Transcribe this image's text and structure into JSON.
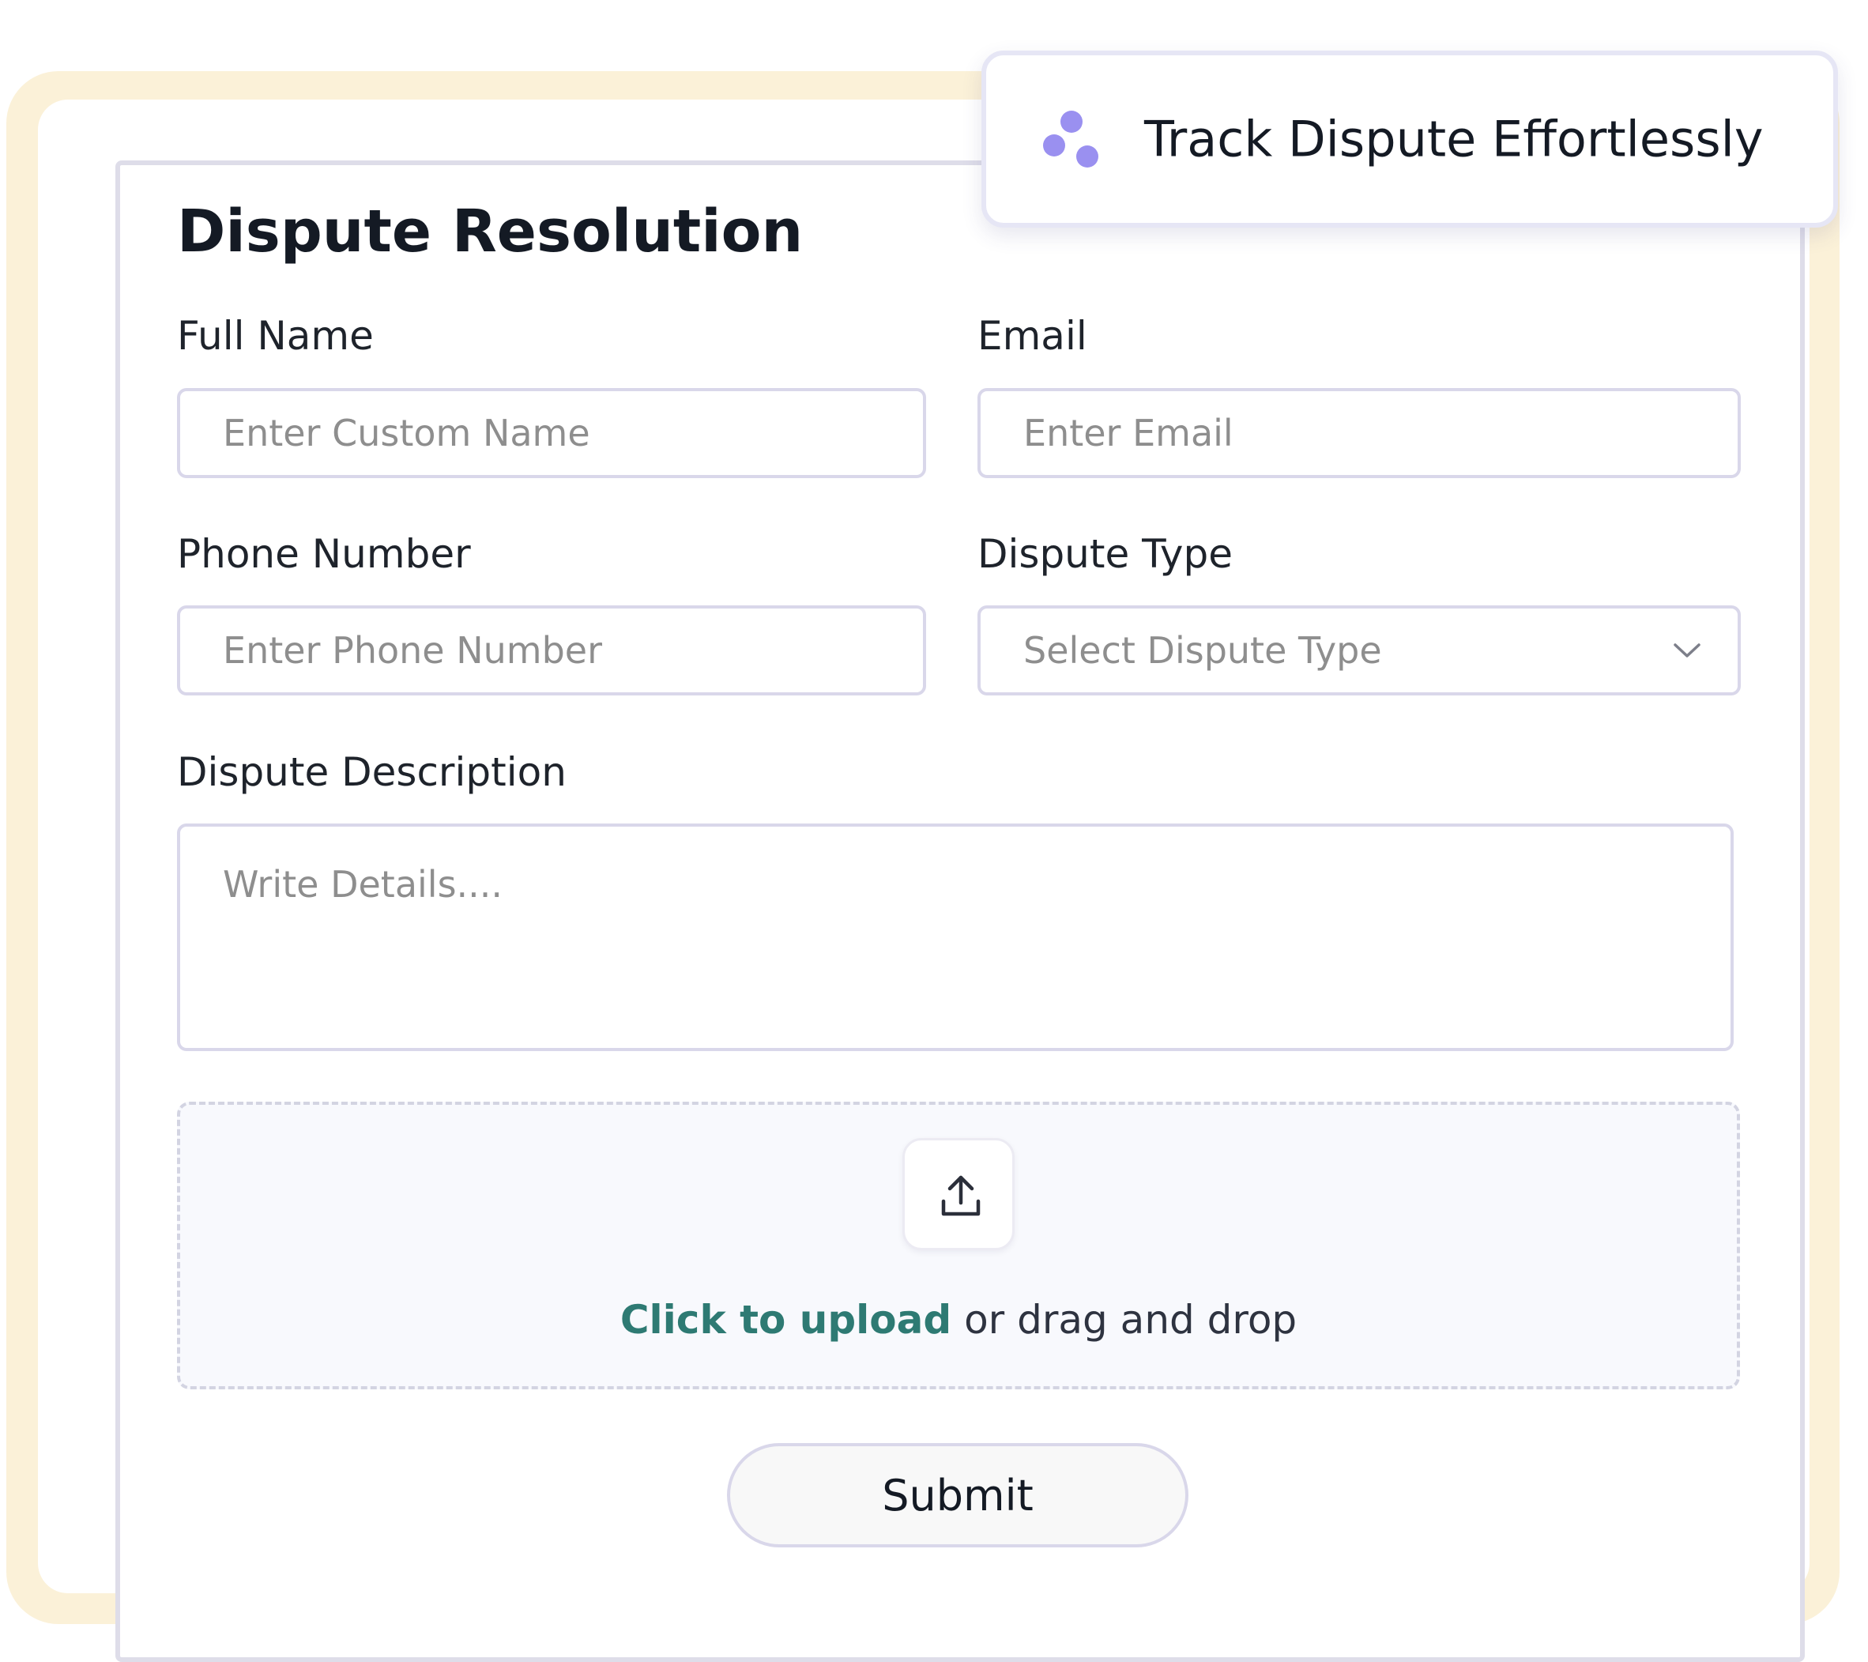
{
  "form": {
    "title": "Dispute Resolution",
    "full_name": {
      "label": "Full Name",
      "placeholder": "Enter Custom Name",
      "value": ""
    },
    "email": {
      "label": "Email",
      "placeholder": "Enter Email",
      "value": ""
    },
    "phone": {
      "label": "Phone Number",
      "placeholder": "Enter Phone Number",
      "value": ""
    },
    "dispute_type": {
      "label": "Dispute Type",
      "selected": "Select Dispute Type"
    },
    "description": {
      "label": "Dispute Description",
      "placeholder": "Write Details....",
      "value": ""
    },
    "upload": {
      "link_text": "Click to upload",
      "rest_text": "or drag and drop",
      "icon": "upload-icon"
    },
    "submit_label": "Submit"
  },
  "toast": {
    "title": "Track Dispute Effortlessly",
    "icon": "dots-icon",
    "accent_color": "#9a90f0"
  },
  "colors": {
    "frame": "#fbf1d8",
    "link": "#2e7a73",
    "border": "#d9d7ea"
  }
}
